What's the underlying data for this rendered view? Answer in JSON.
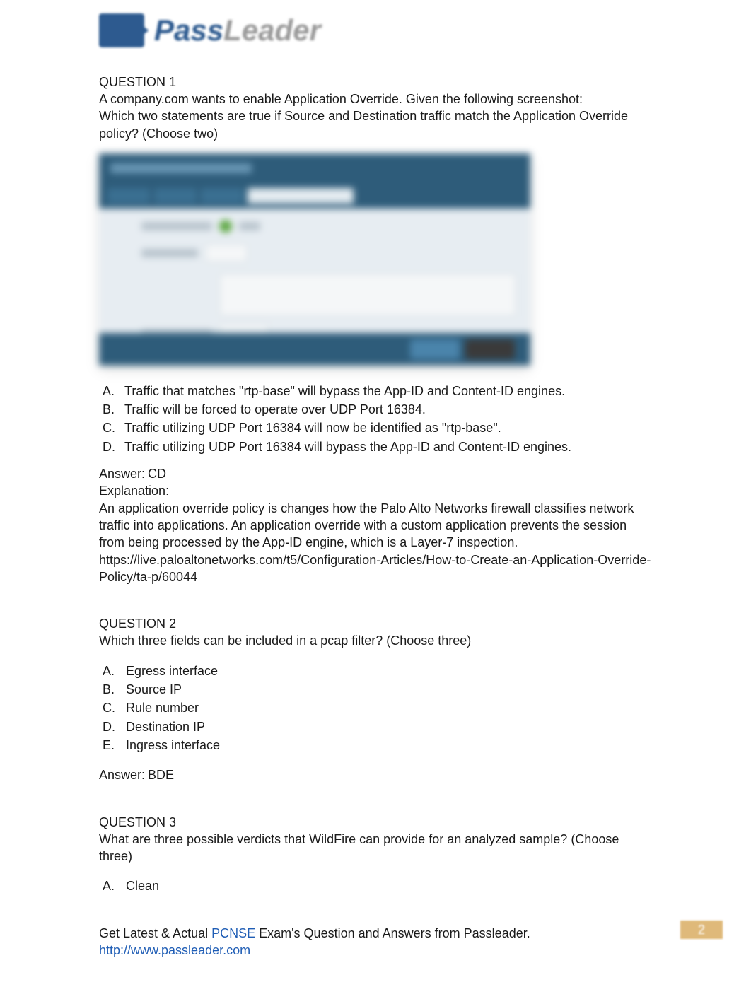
{
  "logo": {
    "brand_pass": "Pass",
    "brand_leader": "Leader"
  },
  "q1": {
    "title": "QUESTION 1",
    "prompt_line1": "A company.com wants to enable Application Override. Given the following screenshot:",
    "prompt_line2": "Which two statements are true if Source and Destination traffic match the Application Override policy? (Choose two)",
    "options": {
      "A": {
        "letter": "A.",
        "text": "Traffic that matches \"rtp-base\" will bypass the App-ID and Content-ID engines."
      },
      "B": {
        "letter": "B.",
        "text": "Traffic will be forced to operate over UDP Port 16384."
      },
      "C": {
        "letter": "C.",
        "text": "Traffic utilizing UDP Port 16384 will now be identified as \"rtp-base\"."
      },
      "D": {
        "letter": "D.",
        "text": "Traffic utilizing UDP Port 16384 will bypass the App-ID and Content-ID engines."
      }
    },
    "answer_label": "Answer:",
    "answer_value": "CD",
    "explanation_label": "Explanation:",
    "explanation_text": "An application override policy is changes how the Palo Alto Networks firewall classifies network traffic into applications. An application override with a custom application prevents the session from being processed by the App-ID engine, which is a Layer-7 inspection.",
    "explanation_link": "https://live.paloaltonetworks.com/t5/Configuration-Articles/How-to-Create-an-Application-Override-Policy/ta-p/60044"
  },
  "q2": {
    "title": "QUESTION 2",
    "prompt": "Which three fields can be included in a pcap filter? (Choose three)",
    "options": {
      "A": {
        "letter": "A.",
        "text": "Egress interface"
      },
      "B": {
        "letter": "B.",
        "text": "Source IP"
      },
      "C": {
        "letter": "C.",
        "text": "Rule number"
      },
      "D": {
        "letter": "D.",
        "text": "Destination IP"
      },
      "E": {
        "letter": "E.",
        "text": "Ingress interface"
      }
    },
    "answer_label": "Answer:",
    "answer_value": "BDE"
  },
  "q3": {
    "title": "QUESTION 3",
    "prompt": "What are three possible verdicts that WildFire can provide for an analyzed sample? (Choose three)",
    "options": {
      "A": {
        "letter": "A.",
        "text": "Clean"
      }
    }
  },
  "footer": {
    "pre_text": "Get Latest & Actual ",
    "exam_code": "PCNSE",
    "post_text": " Exam's Question and Answers from Passleader.",
    "link": "http://www.passleader.com",
    "page_number": "2"
  }
}
